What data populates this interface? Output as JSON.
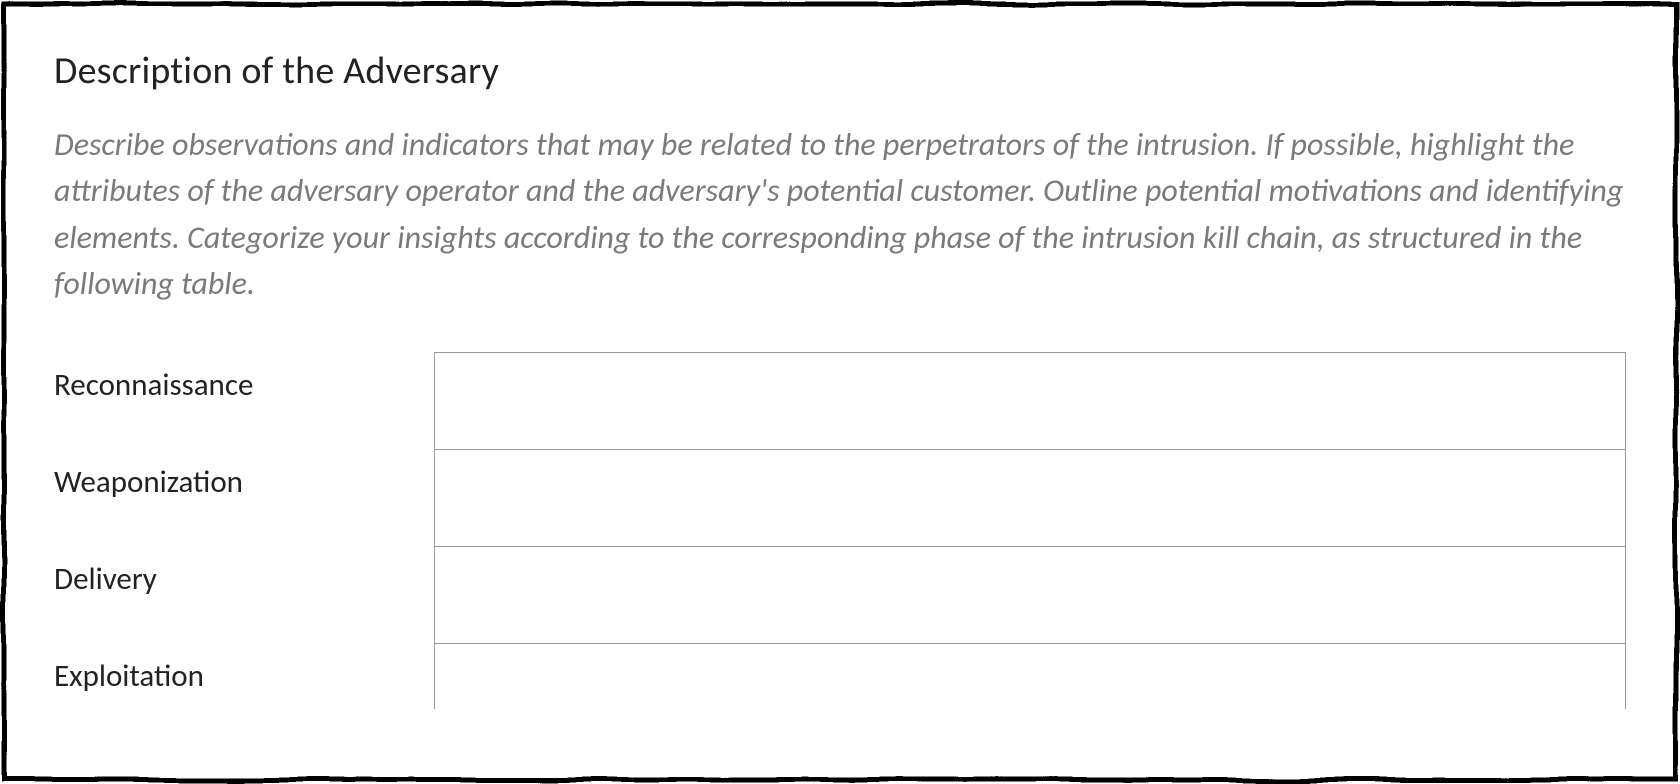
{
  "section": {
    "title": "Description of the Adversary",
    "instruction": "Describe observations and indicators that may be related to the perpetrators of the intrusion. If possible, highlight the attributes of the adversary operator and the adversary's potential customer. Outline potential motivations and identifying elements. Categorize your insights according to the corresponding phase of the intrusion kill chain, as structured in the following table."
  },
  "kill_chain": {
    "rows": [
      {
        "phase": "Reconnaissance",
        "value": ""
      },
      {
        "phase": "Weaponization",
        "value": ""
      },
      {
        "phase": "Delivery",
        "value": ""
      },
      {
        "phase": "Exploitation",
        "value": ""
      }
    ]
  }
}
